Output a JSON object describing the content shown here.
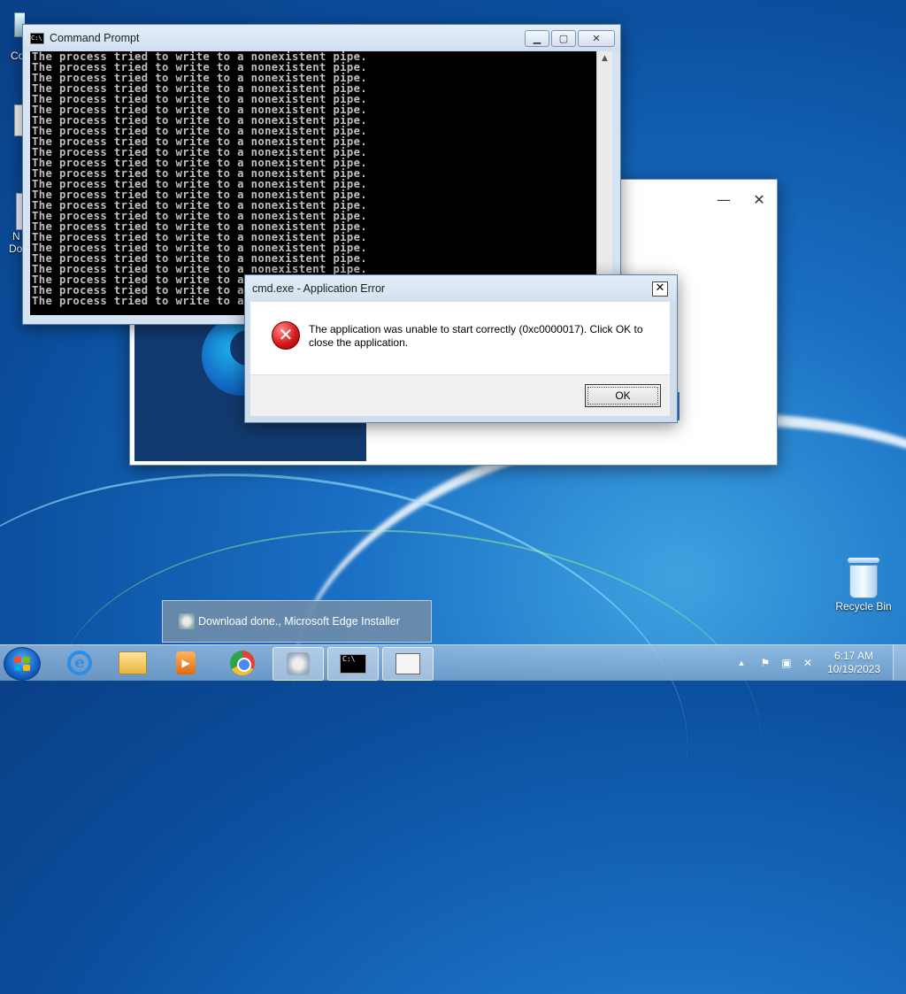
{
  "desktop": {
    "recycle_bin_label": "Recycle Bin",
    "partial_labels": [
      "Co",
      "N",
      "Do"
    ]
  },
  "cmd_window": {
    "title": "Command Prompt",
    "lines": [
      "The process tried to write to a nonexistent pipe.",
      "The process tried to write to a nonexistent pipe.",
      "The process tried to write to a nonexistent pipe.",
      "The process tried to write to a nonexistent pipe.",
      "The process tried to write to a nonexistent pipe.",
      "The process tried to write to a nonexistent pipe.",
      "The process tried to write to a nonexistent pipe.",
      "The process tried to write to a nonexistent pipe.",
      "The process tried to write to a nonexistent pipe.",
      "The process tried to write to a nonexistent pipe.",
      "The process tried to write to a nonexistent pipe.",
      "The process tried to write to a nonexistent pipe.",
      "The process tried to write to a nonexistent pipe.",
      "The process tried to write to a nonexistent pipe.",
      "The process tried to write to a nonexistent pipe.",
      "The process tried to write to a nonexistent pipe.",
      "The process tried to write to a nonexistent pipe.",
      "The process tried to write to a nonexistent pipe.",
      "The process tried to write to a nonexistent pipe.",
      "The process tried to write to a nonexistent pipe.",
      "The process tried to write to a nonexistent pipe.",
      "The process tried to write to a nonexistent pipe.",
      "The process tried to write to a nonexistent pipe.",
      "The process tried to write to a nonexistent pipe."
    ]
  },
  "error_dialog": {
    "title": "cmd.exe - Application Error",
    "message": "The application was unable to start correctly (0xc0000017). Click OK to close the application.",
    "ok_label": "OK",
    "close_glyph": "✕"
  },
  "toast": {
    "text": "Download done., Microsoft Edge Installer"
  },
  "taskbar": {
    "clock_time": "6:17 AM",
    "clock_date": "10/19/2023",
    "tray_expand_glyph": "▲"
  },
  "colors": {
    "console_bg": "#000000",
    "console_text": "#c0c0c0",
    "edge_panel": "#123a6e",
    "error_red": "#d61b1b"
  }
}
